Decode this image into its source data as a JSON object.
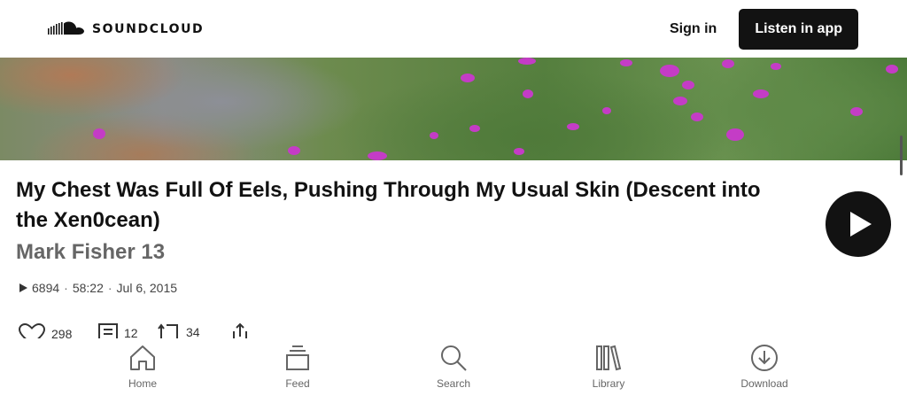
{
  "header": {
    "logo_text": "SOUNDCLOUD",
    "sign_in_label": "Sign in",
    "listen_in_app_label": "Listen in app"
  },
  "track": {
    "title": "My Chest Was Full Of Eels, Pushing Through My Usual Skin (Descent into the Xen0cean)",
    "artist": "Mark Fisher 13",
    "plays": "6894",
    "duration": "58:22",
    "date": "Jul 6, 2015",
    "separator": "·"
  },
  "stats": {
    "likes": "298",
    "comments": "12",
    "reposts": "34"
  },
  "bottom_nav": {
    "items": [
      {
        "label": "Home",
        "icon": "home-icon"
      },
      {
        "label": "Feed",
        "icon": "feed-icon"
      },
      {
        "label": "Search",
        "icon": "search-icon"
      },
      {
        "label": "Library",
        "icon": "library-icon"
      },
      {
        "label": "Download",
        "icon": "download-icon"
      }
    ]
  },
  "colors": {
    "accent": "#121212",
    "muted_text": "#666666",
    "background": "#ffffff"
  }
}
